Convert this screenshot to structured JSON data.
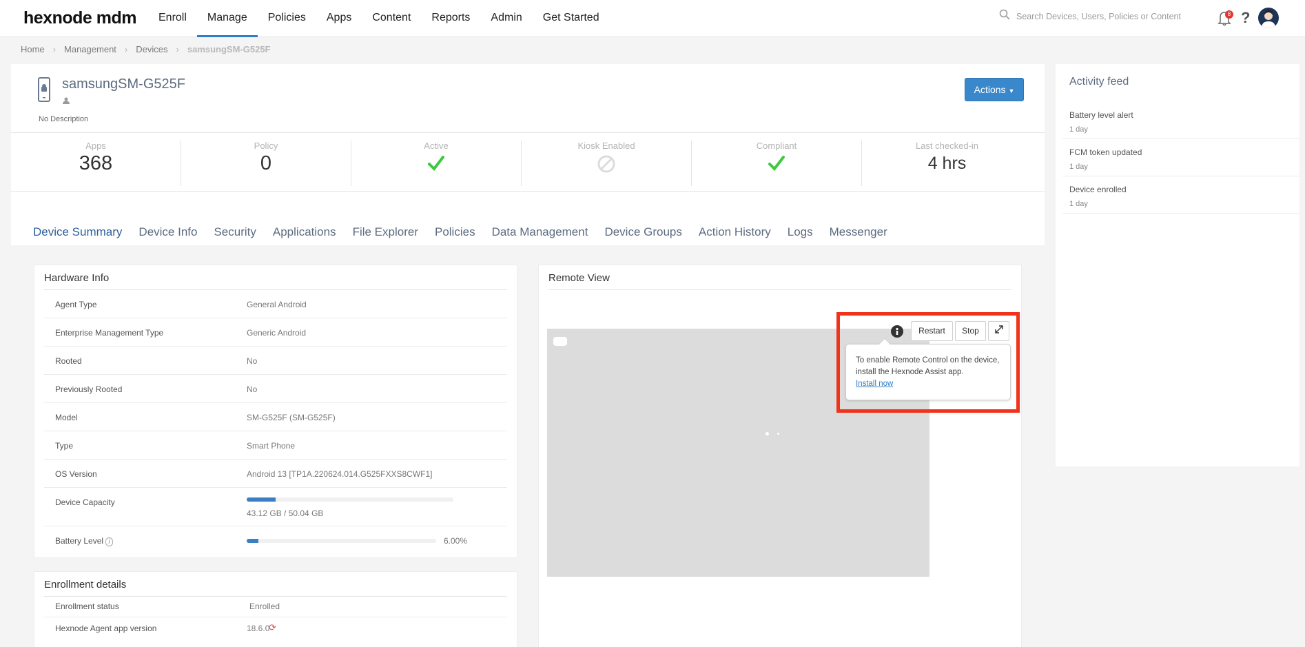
{
  "brand": {
    "logo": "hexnode mdm"
  },
  "nav": {
    "items": [
      "Enroll",
      "Manage",
      "Policies",
      "Apps",
      "Content",
      "Reports",
      "Admin",
      "Get Started"
    ],
    "active": "Manage"
  },
  "search": {
    "placeholder": "Search Devices, Users, Policies or Content"
  },
  "header": {
    "notification_count": "8",
    "help": "?"
  },
  "breadcrumb": {
    "items": [
      "Home",
      "Management",
      "Devices"
    ],
    "current": "samsungSM-G525F"
  },
  "device": {
    "name": "samsungSM-G525F",
    "user": "",
    "description": "No Description",
    "actions_label": "Actions"
  },
  "stats": {
    "apps": {
      "label": "Apps",
      "value": "368"
    },
    "policy": {
      "label": "Policy",
      "value": "0"
    },
    "active": {
      "label": "Active",
      "icon": "check-icon"
    },
    "kiosk": {
      "label": "Kiosk Enabled",
      "icon": "disabled-icon"
    },
    "compliant": {
      "label": "Compliant",
      "icon": "check-icon"
    },
    "last_checked": {
      "label": "Last checked-in",
      "value": "4 hrs"
    }
  },
  "tabs": [
    "Device Summary",
    "Device Info",
    "Security",
    "Applications",
    "File Explorer",
    "Policies",
    "Data Management",
    "Device Groups",
    "Action History",
    "Logs",
    "Messenger"
  ],
  "active_tab": "Device Summary",
  "hardware": {
    "title": "Hardware Info",
    "rows": [
      {
        "label": "Agent Type",
        "value": "General Android"
      },
      {
        "label": "Enterprise Management Type",
        "value": "Generic Android"
      },
      {
        "label": "Rooted",
        "value": "No"
      },
      {
        "label": "Previously Rooted",
        "value": "No"
      },
      {
        "label": "Model",
        "value": "SM-G525F (SM-G525F)"
      },
      {
        "label": "Type",
        "value": "Smart Phone"
      },
      {
        "label": "OS Version",
        "value": "Android 13 [TP1A.220624.014.G525FXXS8CWF1]"
      },
      {
        "label": "Device Capacity",
        "value": "43.12 GB / 50.04 GB",
        "fraction": 0.14
      },
      {
        "label": "Battery Level",
        "value": "6.00%",
        "fraction": 0.06
      }
    ]
  },
  "enrollment": {
    "title": "Enrollment details",
    "rows": [
      {
        "label": "Enrollment status",
        "value": "Enrolled"
      },
      {
        "label": "Hexnode Agent app version",
        "value": "18.6.0"
      }
    ]
  },
  "remote": {
    "title": "Remote View",
    "restart_label": "Restart",
    "stop_label": "Stop",
    "tooltip_text": "To enable Remote Control on the device, install the Hexnode Assist app.",
    "install_link": "Install now"
  },
  "feed": {
    "title": "Activity feed",
    "items": [
      {
        "title": "Battery level alert",
        "time": "1 day"
      },
      {
        "title": "FCM token updated",
        "time": "1 day"
      },
      {
        "title": "Device enrolled",
        "time": "1 day"
      }
    ]
  },
  "colors": {
    "accent": "#2f7dc9",
    "check": "#3dc93d",
    "highlight": "#f2331b"
  }
}
